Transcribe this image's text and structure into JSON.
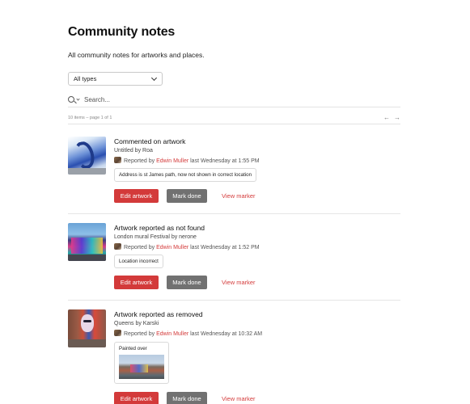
{
  "header": {
    "title": "Community notes",
    "subtitle": "All community notes for artworks and places."
  },
  "filter": {
    "type_selected": "All types"
  },
  "search": {
    "placeholder": "Search..."
  },
  "pager": {
    "summary": "10 items – page 1 of 1",
    "prev_icon": "arrow-left-icon",
    "next_icon": "arrow-right-icon"
  },
  "notes": [
    {
      "title": "Commented on artwork",
      "artwork": "Untitled by Roa",
      "reported_prefix": "Reported by",
      "reporter": "Edwin Muller",
      "reported_when": "last Wednesday at 1:55 PM",
      "comment": "Address is st James path, now not shown in correct location",
      "edit_label": "Edit artwork",
      "done_label": "Mark done",
      "view_label": "View marker"
    },
    {
      "title": "Artwork reported as not found",
      "artwork": "London mural Festival by nerone",
      "reported_prefix": "Reported by",
      "reporter": "Edwin Muller",
      "reported_when": "last Wednesday at 1:52 PM",
      "comment": "Location incorrect",
      "edit_label": "Edit artwork",
      "done_label": "Mark done",
      "view_label": "View marker"
    },
    {
      "title": "Artwork reported as removed",
      "artwork": "Queens by Karski",
      "reported_prefix": "Reported by",
      "reporter": "Edwin Muller",
      "reported_when": "last Wednesday at 10:32 AM",
      "comment": "Painted over",
      "edit_label": "Edit artwork",
      "done_label": "Mark done",
      "view_label": "View marker"
    }
  ],
  "colors": {
    "accent": "#d33a3a",
    "secondary_button": "#717171",
    "link": "#d43b3b"
  }
}
